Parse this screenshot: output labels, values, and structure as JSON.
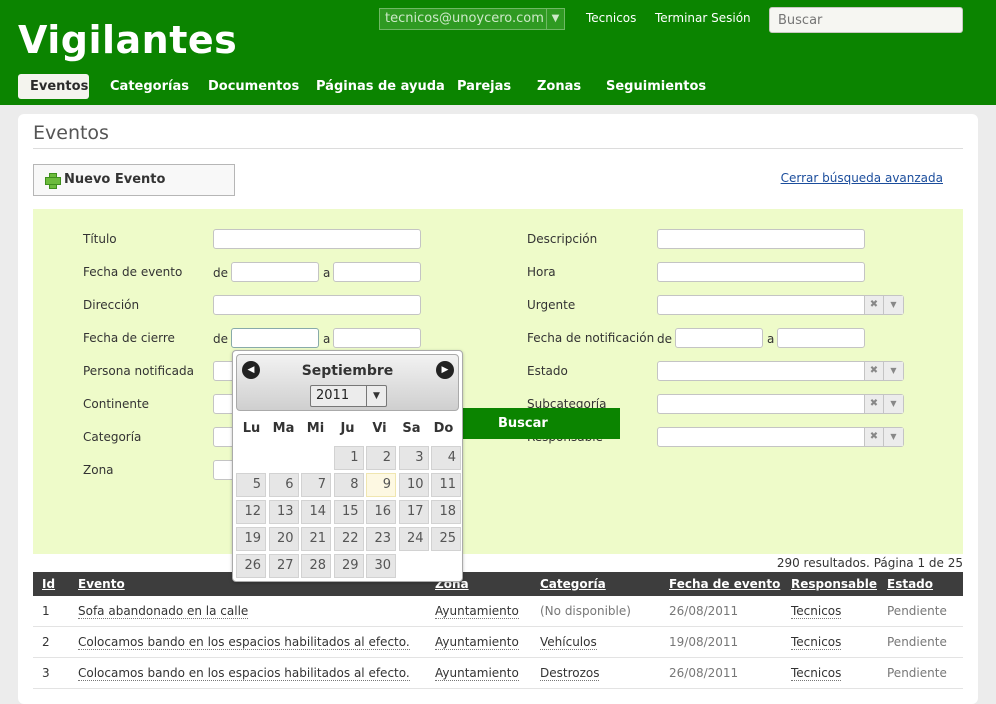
{
  "app": {
    "title": "Vigilantes"
  },
  "topbar": {
    "user": "tecnicos@unoycero.com",
    "link1": "Tecnicos",
    "link2": "Terminar Sesión",
    "search_placeholder": "Buscar"
  },
  "nav": {
    "tabs": [
      "Eventos",
      "Categorías",
      "Documentos",
      "Páginas de ayuda",
      "Parejas",
      "Zonas",
      "Seguimientos"
    ]
  },
  "page": {
    "title": "Eventos",
    "new_button": "Nuevo Evento",
    "close_search": "Cerrar búsqueda avanzada"
  },
  "search": {
    "left_labels": [
      "Título",
      "Fecha de evento",
      "Dirección",
      "Fecha de cierre",
      "Persona notificada",
      "Continente",
      "Categoría",
      "Zona"
    ],
    "right_labels": [
      "Descripción",
      "Hora",
      "Urgente",
      "Fecha de notificación",
      "Estado",
      "Subcategoría",
      "Responsable"
    ],
    "de": "de",
    "a": "a",
    "button": "Buscar"
  },
  "datepicker": {
    "month": "Septiembre",
    "year": "2011",
    "weekdays": [
      "Lu",
      "Ma",
      "Mi",
      "Ju",
      "Vi",
      "Sa",
      "Do"
    ],
    "days": [
      "1",
      "2",
      "3",
      "4",
      "5",
      "6",
      "7",
      "8",
      "9",
      "10",
      "11",
      "12",
      "13",
      "14",
      "15",
      "16",
      "17",
      "18",
      "19",
      "20",
      "21",
      "22",
      "23",
      "24",
      "25",
      "26",
      "27",
      "28",
      "29",
      "30"
    ],
    "today": "9"
  },
  "results": {
    "summary": "290 resultados. Página 1 de 25"
  },
  "table": {
    "columns": [
      "Id",
      "Evento",
      "Zona",
      "Categoría",
      "Fecha de evento",
      "Responsable",
      "Estado"
    ],
    "rows": [
      [
        "1",
        "Sofa abandonado en la calle",
        "Ayuntamiento",
        "(No disponible)",
        "26/08/2011",
        "Tecnicos",
        "Pendiente"
      ],
      [
        "2",
        "Colocamos bando en los espacios habilitados al efecto.",
        "Ayuntamiento",
        "Vehículos",
        "19/08/2011",
        "Tecnicos",
        "Pendiente"
      ],
      [
        "3",
        "Colocamos bando en los espacios habilitados al efecto.",
        "Ayuntamiento",
        "Destrozos",
        "26/08/2011",
        "Tecnicos",
        "Pendiente"
      ]
    ]
  },
  "colors": {
    "brand": "#0b8400",
    "search_bg": "#eefbc9",
    "table_head": "#3d3d3d"
  }
}
